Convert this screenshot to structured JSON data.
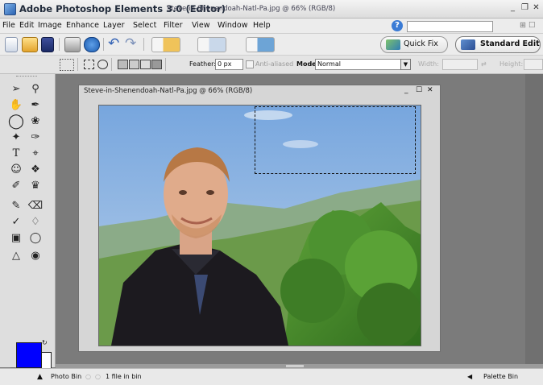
{
  "window": {
    "app_title": "Adobe Photoshop Elements 3.0 (Editor)",
    "doc_title": "Steve-in-Shenendoah-Natl-Pa.jpg @ 66% (RGB/8)",
    "minimize": "_",
    "restore": "❐",
    "close": "✕"
  },
  "menu": {
    "items": [
      "File",
      "Edit",
      "Image",
      "Enhance",
      "Layer",
      "Select",
      "Filter",
      "View",
      "Window",
      "Help"
    ],
    "help_icon": "?",
    "search_placeholder": "",
    "right_glyphs": "⊞ ☐"
  },
  "modes": {
    "quick_fix": "Quick Fix",
    "standard_edit": "Standard Edit"
  },
  "options": {
    "feather_label": "Feather:",
    "feather_value": "0 px",
    "antialiased_label": "Anti-aliased",
    "mode_label": "Mode:",
    "mode_value": "Normal",
    "width_label": "Width:",
    "height_label": "Height:"
  },
  "document": {
    "title": "Steve-in-Shenendoah-Natl-Pa.jpg @ 66% (RGB/8)",
    "minimize": "_",
    "restore": "☐",
    "close": "✕"
  },
  "status": {
    "photo_bin": "Photo Bin",
    "file_count": "1 file in bin",
    "palette_bin": "Palette Bin"
  },
  "colors": {
    "foreground": "#0000ff",
    "background": "#ffffff"
  }
}
